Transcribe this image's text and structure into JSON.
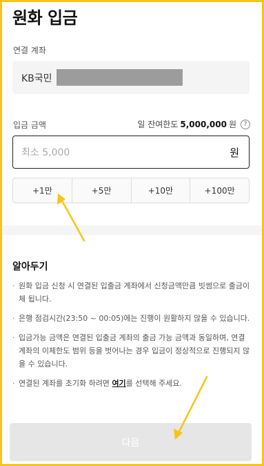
{
  "page": {
    "title": "원화 입금"
  },
  "account": {
    "label": "연결 계좌",
    "bank": "KB국민"
  },
  "amount": {
    "label": "입금 금액",
    "limit_prefix": "일 잔여한도",
    "limit_value": "5,000,000",
    "limit_unit": "원",
    "help_icon": "?",
    "placeholder": "최소 5,000",
    "value": "",
    "unit": "원"
  },
  "quick_buttons": [
    "+1만",
    "+5만",
    "+10만",
    "+100만"
  ],
  "notice": {
    "title": "알아두기",
    "items": [
      "원화 입금 신청 시 연결된 입출금 계좌에서 신청금액만큼 빗썸으로 출금이체 됩니다.",
      "은행 점검시간(23:50 ~ 00:05)에는 진행이 원활하지 않을 수 있습니다.",
      "입금가능 금액은 연결된 입출금 계좌의 출금 가능 금액과 동일하며, 연결 계좌의 이체한도 범위 등을 벗어나는 경우 입금이 정상적으로 진행되지 않을 수 있습니다."
    ],
    "last_item": {
      "before": "연결된 계좌를 초기화 하려면 ",
      "link": "여기",
      "after": "를 선택해 주세요."
    }
  },
  "submit": {
    "label": "다음"
  },
  "colors": {
    "highlight_border": "#f5c518",
    "arrow": "#f5c518",
    "submit_disabled_bg": "#e6e6e6",
    "mask": "#9c9c9c"
  }
}
